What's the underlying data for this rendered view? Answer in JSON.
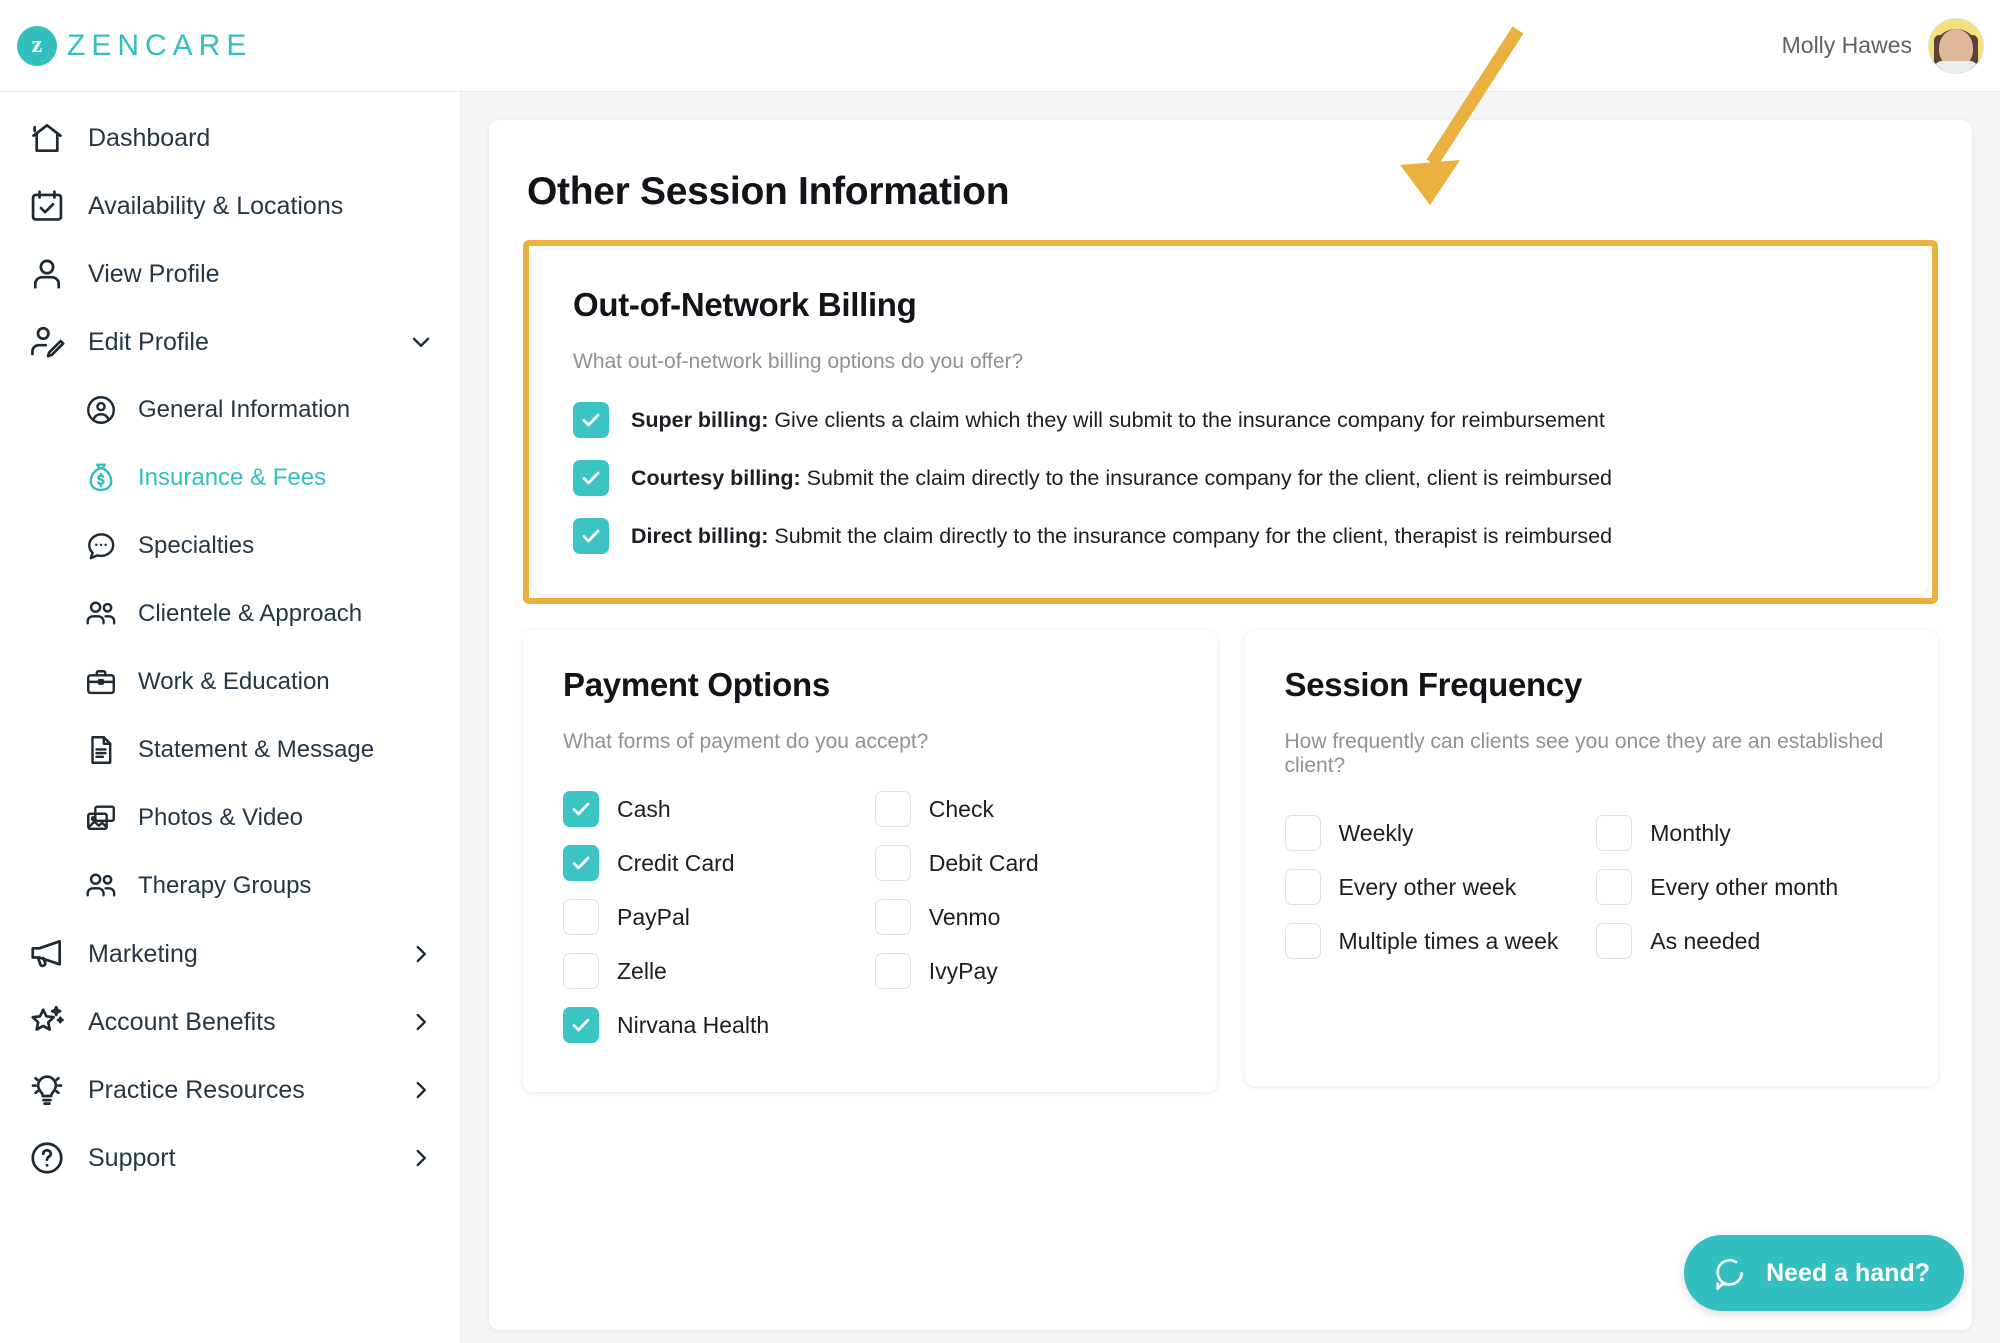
{
  "brand": {
    "name": "ZENCARE",
    "mark": "z",
    "accent": "#33bfc0",
    "highlight": "#eab040"
  },
  "header": {
    "user_name": "Molly Hawes",
    "avatar_alt": "user-avatar"
  },
  "sidebar": {
    "items": [
      {
        "label": "Dashboard",
        "icon": "home-icon",
        "level": "top",
        "active": false,
        "chevron": ""
      },
      {
        "label": "Availability & Locations",
        "icon": "calendar-check-icon",
        "level": "top",
        "active": false,
        "chevron": ""
      },
      {
        "label": "View Profile",
        "icon": "user-icon",
        "level": "top",
        "active": false,
        "chevron": ""
      },
      {
        "label": "Edit Profile",
        "icon": "user-edit-icon",
        "level": "top",
        "active": false,
        "chevron": "down"
      },
      {
        "label": "General Information",
        "icon": "user-circle-icon",
        "level": "sub",
        "active": false,
        "chevron": ""
      },
      {
        "label": "Insurance & Fees",
        "icon": "money-bag-icon",
        "level": "sub",
        "active": true,
        "chevron": ""
      },
      {
        "label": "Specialties",
        "icon": "chat-bubble-icon",
        "level": "sub",
        "active": false,
        "chevron": ""
      },
      {
        "label": "Clientele & Approach",
        "icon": "users-icon",
        "level": "sub",
        "active": false,
        "chevron": ""
      },
      {
        "label": "Work & Education",
        "icon": "briefcase-icon",
        "level": "sub",
        "active": false,
        "chevron": ""
      },
      {
        "label": "Statement & Message",
        "icon": "document-icon",
        "level": "sub",
        "active": false,
        "chevron": ""
      },
      {
        "label": "Photos & Video",
        "icon": "photo-video-icon",
        "level": "sub",
        "active": false,
        "chevron": ""
      },
      {
        "label": "Therapy Groups",
        "icon": "users-icon",
        "level": "sub",
        "active": false,
        "chevron": ""
      },
      {
        "label": "Marketing",
        "icon": "megaphone-icon",
        "level": "top",
        "active": false,
        "chevron": "right"
      },
      {
        "label": "Account Benefits",
        "icon": "star-sparkle-icon",
        "level": "top",
        "active": false,
        "chevron": "right"
      },
      {
        "label": "Practice Resources",
        "icon": "lightbulb-icon",
        "level": "top",
        "active": false,
        "chevron": "right"
      },
      {
        "label": "Support",
        "icon": "question-circle-icon",
        "level": "top",
        "active": false,
        "chevron": "right"
      }
    ]
  },
  "main": {
    "page_title": "Other Session Information",
    "out_of_network": {
      "title": "Out-of-Network Billing",
      "question": "What out-of-network billing options do you offer?",
      "options": [
        {
          "bold": "Super billing:",
          "rest": " Give clients a claim which they will submit to the insurance company for reimbursement",
          "checked": true
        },
        {
          "bold": "Courtesy billing:",
          "rest": " Submit the claim directly to the insurance company for the client, client is reimbursed",
          "checked": true
        },
        {
          "bold": "Direct billing:",
          "rest": " Submit the claim directly to the insurance company for the client, therapist is reimbursed",
          "checked": true
        }
      ]
    },
    "payment_options": {
      "title": "Payment Options",
      "question": "What forms of payment do you accept?",
      "options": [
        {
          "label": "Cash",
          "checked": true
        },
        {
          "label": "Check",
          "checked": false
        },
        {
          "label": "Credit Card",
          "checked": true
        },
        {
          "label": "Debit Card",
          "checked": false
        },
        {
          "label": "PayPal",
          "checked": false
        },
        {
          "label": "Venmo",
          "checked": false
        },
        {
          "label": "Zelle",
          "checked": false
        },
        {
          "label": "IvyPay",
          "checked": false
        },
        {
          "label": "Nirvana Health",
          "checked": true
        },
        {
          "label": "",
          "checked": false
        }
      ]
    },
    "session_frequency": {
      "title": "Session Frequency",
      "question": "How frequently can clients see you once they are an established client?",
      "options": [
        {
          "label": "Weekly",
          "checked": false
        },
        {
          "label": "Monthly",
          "checked": false
        },
        {
          "label": "Every other week",
          "checked": false
        },
        {
          "label": "Every other month",
          "checked": false
        },
        {
          "label": "Multiple times a week",
          "checked": false
        },
        {
          "label": "As needed",
          "checked": false
        }
      ]
    }
  },
  "support_widget": {
    "label": "Need a hand?",
    "icon": "chat-bubble-icon"
  },
  "annotation": {
    "arrow_color": "#eab040",
    "highlight_color": "#eab040"
  }
}
